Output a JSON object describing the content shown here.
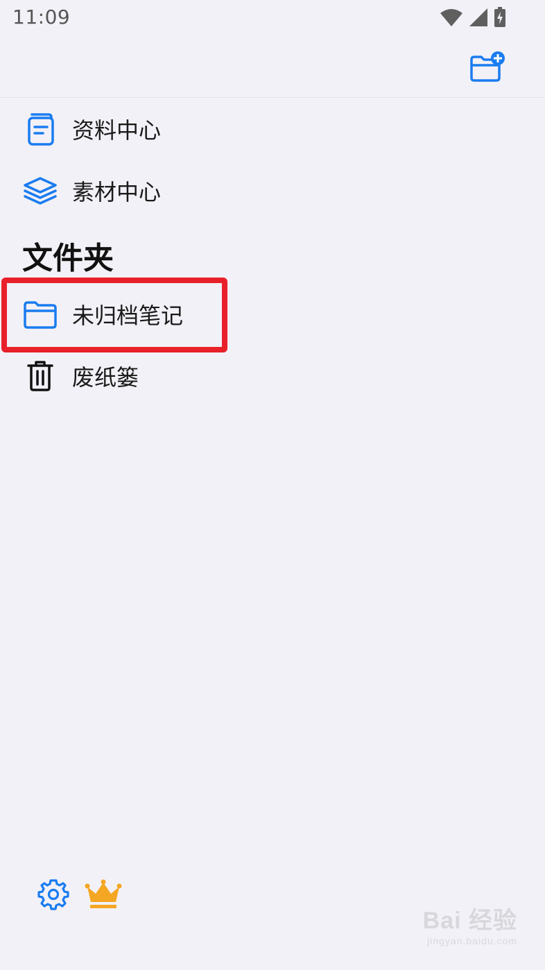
{
  "status_bar": {
    "time": "11:09",
    "icons": [
      "wifi-icon",
      "cellular-signal-icon",
      "battery-charging-icon"
    ]
  },
  "header": {
    "new_folder_icon": "folder-add-icon",
    "accent_color": "#1a7cf0"
  },
  "menu": {
    "items": [
      {
        "label": "资料中心",
        "icon": "document-center-icon"
      },
      {
        "label": "素材中心",
        "icon": "layers-icon"
      }
    ]
  },
  "folders": {
    "title": "文件夹",
    "items": [
      {
        "label": "未归档笔记",
        "icon": "folder-icon",
        "highlighted": true
      },
      {
        "label": "废纸篓",
        "icon": "trash-icon"
      }
    ]
  },
  "bottom": {
    "settings_icon": "gear-icon",
    "vip_icon": "crown-icon",
    "vip_color": "#f5a623"
  },
  "watermark": {
    "main": "Bai 经验",
    "sub": "jingyan.baidu.com"
  },
  "highlight_color": "#e8202a"
}
